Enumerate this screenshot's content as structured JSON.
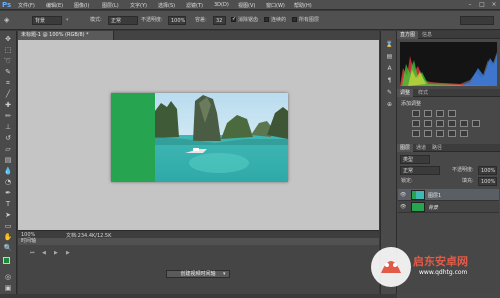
{
  "app": {
    "logo": "Ps"
  },
  "menu": {
    "items": [
      "文件(F)",
      "编辑(E)",
      "图像(I)",
      "图层(L)",
      "文字(Y)",
      "选择(S)",
      "滤镜(T)",
      "3D(D)",
      "视图(V)",
      "窗口(W)",
      "帮助(H)"
    ]
  },
  "options": {
    "preset": "背景",
    "mode_label": "模式:",
    "mode_value": "正常",
    "opacity_label": "不透明度:",
    "opacity_value": "100%",
    "tolerance_label": "容差:",
    "tolerance_value": "32",
    "antialias_label": "消除锯齿",
    "contiguous_label": "连续的",
    "all_layers_label": "所有图层"
  },
  "document": {
    "tab_title": "未标题-1 @ 100% (RGB/8) *",
    "status_zoom": "100%",
    "status_doc": "文档:234.4K/12.5K"
  },
  "timeline": {
    "title": "时间轴",
    "create_label": "创建视频时间轴"
  },
  "panels": {
    "histogram_tabs": [
      "直方图",
      "信息"
    ],
    "adjust_tabs": [
      "调整",
      "样式"
    ],
    "adjust_title": "添加调整",
    "layers_tabs": [
      "图层",
      "通道",
      "路径"
    ],
    "kind_label": "类型",
    "blend_mode": "正常",
    "opacity_label": "不透明度:",
    "opacity_value": "100%",
    "lock_label": "锁定:",
    "fill_label": "填充:",
    "fill_value": "100%",
    "layers": [
      {
        "name": "图层1"
      },
      {
        "name": "背景"
      }
    ]
  },
  "watermark": {
    "brand": "启东安卓网",
    "url": "www.qdhtg.com"
  },
  "colors": {
    "accent_green": "#27a44f",
    "ps_blue": "#5fb0ff",
    "watermark_red": "#e25b47"
  }
}
